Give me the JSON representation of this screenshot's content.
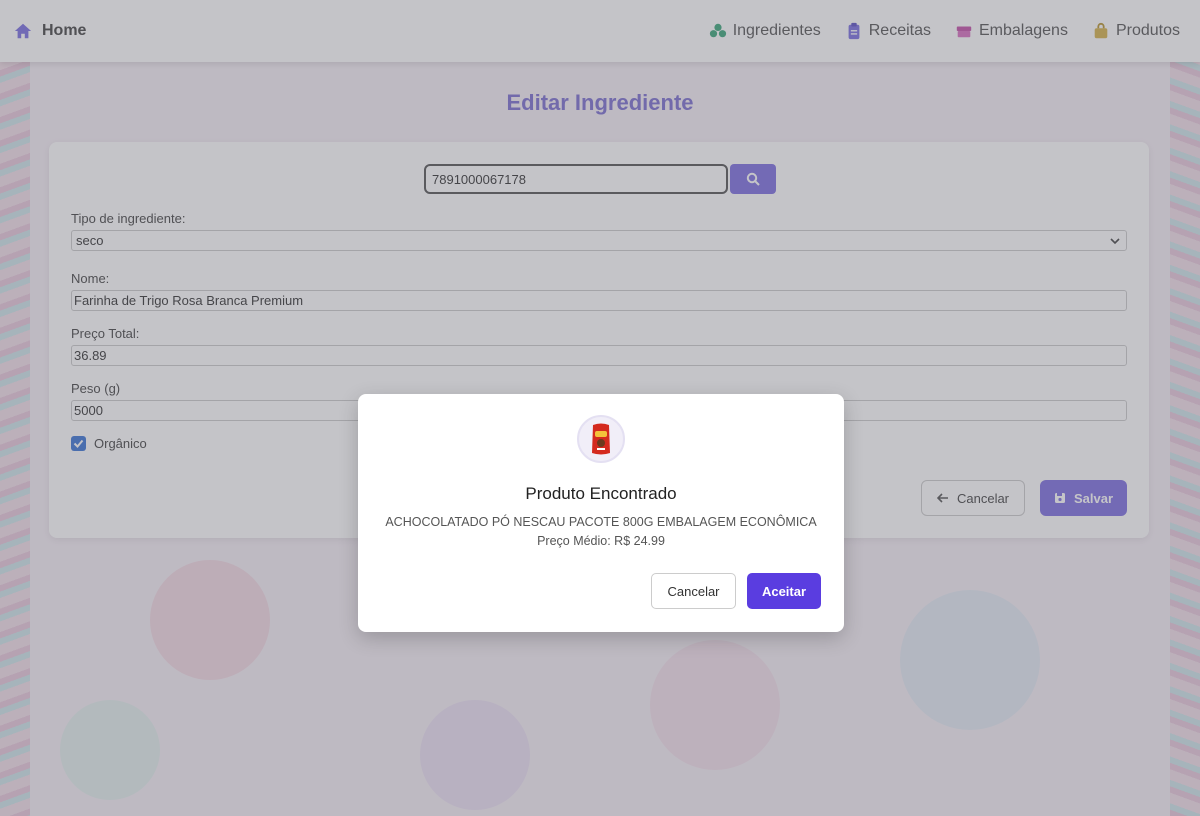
{
  "colors": {
    "accent": "#7d6fe0",
    "accept": "#5a3de0",
    "title": "#7b6fd0",
    "checkbox": "#3b74d6"
  },
  "nav": {
    "home_label": "Home",
    "home_icon": "home-icon",
    "links": [
      {
        "label": "Ingredientes",
        "icon": "ingredients-icon",
        "color": "#3aa67a"
      },
      {
        "label": "Receitas",
        "icon": "clipboard-icon",
        "color": "#7a6ee0"
      },
      {
        "label": "Embalagens",
        "icon": "box-icon",
        "color": "#c44fa8"
      },
      {
        "label": "Produtos",
        "icon": "bag-icon",
        "color": "#d6b24a"
      }
    ]
  },
  "page": {
    "title": "Editar Ingrediente"
  },
  "form": {
    "barcode_value": "7891000067178",
    "type_label": "Tipo de ingrediente:",
    "type_value": "seco",
    "name_label": "Nome:",
    "name_value": "Farinha de Trigo Rosa Branca Premium",
    "price_label": "Preço Total:",
    "price_value": "36.89",
    "weight_label": "Peso (g)",
    "weight_value": "5000",
    "organic_label": "Orgânico",
    "organic_checked": true,
    "cancel_label": "Cancelar",
    "save_label": "Salvar"
  },
  "modal": {
    "title": "Produto Encontrado",
    "description": "ACHOCOLATADO PÓ NESCAU PACOTE 800G EMBALAGEM ECONÔMICA",
    "price": "Preço Médio: R$ 24.99",
    "cancel_label": "Cancelar",
    "accept_label": "Aceitar"
  }
}
